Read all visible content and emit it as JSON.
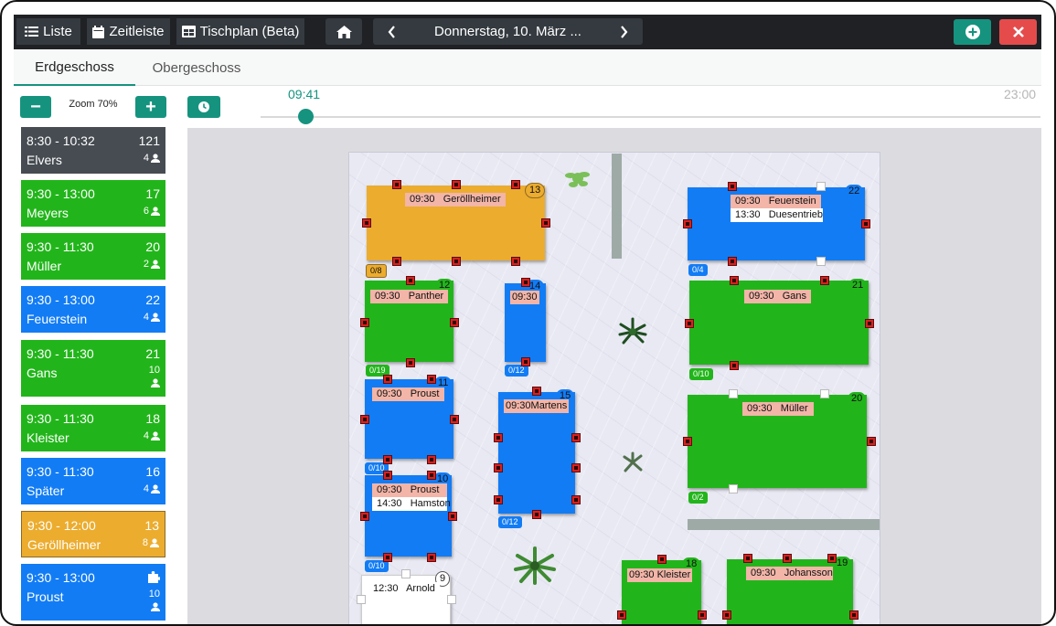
{
  "toolbar": {
    "list_label": "Liste",
    "timeline_label": "Zeitleiste",
    "tableplan_label": "Tischplan (Beta)",
    "date_label": "Donnerstag, 10. März ..."
  },
  "floors": {
    "tab1": "Erdgeschoss",
    "tab2": "Obergeschoss"
  },
  "zoom": {
    "label": "Zoom 70%"
  },
  "timeline": {
    "now": "09:41",
    "end": "23:00",
    "progress_fraction": 0.05
  },
  "colors": {
    "accent": "#15937f",
    "danger": "#e54b4b",
    "orange": "#ecac2e",
    "blue": "#127cf5",
    "green": "#22b51b",
    "dark": "#464c52"
  },
  "reservations": [
    {
      "time": "8:30 - 10:32",
      "name": "Elvers",
      "table": "121",
      "persons": "4"
    },
    {
      "time": "9:30 - 13:00",
      "name": "Meyers",
      "table": "17",
      "persons": "6"
    },
    {
      "time": "9:30 - 11:30",
      "name": "Müller",
      "table": "20",
      "persons": "2"
    },
    {
      "time": "9:30 - 13:00",
      "name": "Feuerstein",
      "table": "22",
      "persons": "4"
    },
    {
      "time": "9:30 - 11:30",
      "name": "Gans",
      "table": "21",
      "persons": "10"
    },
    {
      "time": "9:30 - 11:30",
      "name": "Kleister",
      "table": "18",
      "persons": "4"
    },
    {
      "time": "9:30 - 11:30",
      "name": "Später",
      "table": "16",
      "persons": "4"
    },
    {
      "time": "9:30 - 12:00",
      "name": "Geröllheimer",
      "table": "13",
      "persons": "8"
    },
    {
      "time": "9:30 - 13:00",
      "name": "Proust",
      "table": "",
      "persons": "10"
    }
  ],
  "tables": {
    "t13": {
      "num": "13",
      "cap": "0/8",
      "labels": [
        "09:30   Geröllheimer"
      ]
    },
    "t22": {
      "num": "22",
      "cap": "0/4",
      "labels": [
        "09:30   Feuerstein",
        "13:30   Duesentrieb"
      ]
    },
    "t12": {
      "num": "12",
      "cap": "0/19",
      "labels": [
        "09:30   Panther"
      ]
    },
    "t14": {
      "num": "14",
      "cap": "0/12",
      "labels": [
        "09:30"
      ]
    },
    "t21": {
      "num": "21",
      "cap": "0/10",
      "labels": [
        "09:30   Gans"
      ]
    },
    "t11": {
      "num": "11",
      "cap": "0/10",
      "labels": [
        "09:30   Proust"
      ]
    },
    "t15": {
      "num": "15",
      "cap": "0/12",
      "labels": [
        "09:30Martens"
      ]
    },
    "t20": {
      "num": "20",
      "cap": "0/2",
      "labels": [
        "09:30   Müller"
      ]
    },
    "t10": {
      "num": "10",
      "cap": "0/10",
      "labels": [
        "09:30   Proust",
        "14:30   Hamston"
      ]
    },
    "t9": {
      "num": "9",
      "labels": [
        "12:30   Arnold"
      ]
    },
    "t18": {
      "num": "18",
      "labels": [
        "09:30 Kleister"
      ]
    },
    "t19": {
      "num": "19",
      "labels": [
        "09:30   Johansson"
      ]
    }
  }
}
